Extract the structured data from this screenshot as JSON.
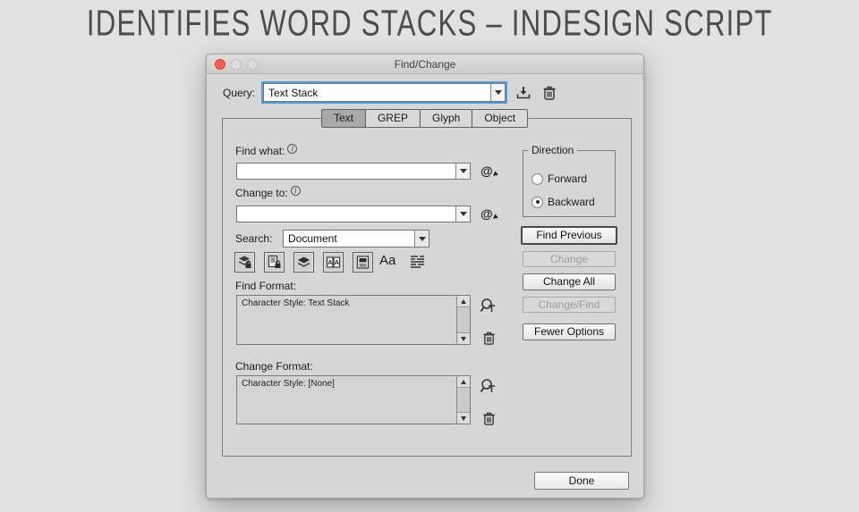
{
  "heading": "IDENTIFIES WORD STACKS – INDESIGN SCRIPT",
  "dialog": {
    "title": "Find/Change",
    "query": {
      "label": "Query:",
      "value": "Text Stack"
    },
    "tabs": [
      {
        "label": "Text",
        "selected": true
      },
      {
        "label": "GREP",
        "selected": false
      },
      {
        "label": "Glyph",
        "selected": false
      },
      {
        "label": "Object",
        "selected": false
      }
    ],
    "find_what": {
      "label": "Find what:",
      "value": ""
    },
    "change_to": {
      "label": "Change to:",
      "value": ""
    },
    "search": {
      "label": "Search:",
      "value": "Document"
    },
    "special_chars_symbol": "@",
    "scope_icons": [
      {
        "name": "include-locked-layers-icon",
        "active": true
      },
      {
        "name": "include-locked-stories-icon",
        "active": true
      },
      {
        "name": "include-hidden-layers-icon",
        "active": true
      },
      {
        "name": "include-master-pages-icon",
        "active": true,
        "letter": "A"
      },
      {
        "name": "include-footnotes-icon",
        "active": true
      },
      {
        "name": "case-sensitive-icon",
        "active": false,
        "label": "Aa"
      },
      {
        "name": "whole-word-icon",
        "active": false
      }
    ],
    "find_format": {
      "label": "Find Format:",
      "value": "Character Style: Text Stack"
    },
    "change_format": {
      "label": "Change Format:",
      "value": "Character Style: [None]"
    },
    "direction": {
      "legend": "Direction",
      "options": [
        {
          "label": "Forward",
          "selected": false
        },
        {
          "label": "Backward",
          "selected": true
        }
      ]
    },
    "buttons": {
      "find_previous": {
        "label": "Find Previous",
        "enabled": true
      },
      "change": {
        "label": "Change",
        "enabled": false
      },
      "change_all": {
        "label": "Change All",
        "enabled": true
      },
      "change_find": {
        "label": "Change/Find",
        "enabled": false
      },
      "fewer_options": {
        "label": "Fewer Options",
        "enabled": true
      },
      "done": {
        "label": "Done",
        "enabled": true
      }
    },
    "colors": {
      "focus_ring": "#4f9bd5",
      "close_button": "#fa5b52",
      "dialog_bg": "#d6d6d6",
      "page_bg": "#e1e1e1",
      "selected_tab_bg": "#a9a9a9"
    }
  }
}
